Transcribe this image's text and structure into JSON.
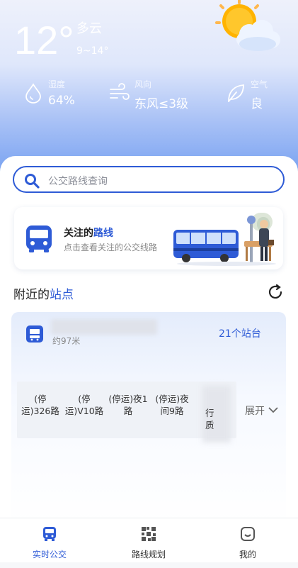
{
  "weather": {
    "temperature": "12°",
    "condition": "多云",
    "range": "9~14°",
    "humidity": {
      "label": "湿度",
      "value": "64%"
    },
    "wind": {
      "label": "风向",
      "value": "东风≤3级"
    },
    "air": {
      "label": "空气",
      "value": "良"
    }
  },
  "search": {
    "placeholder": "公交路线查询"
  },
  "follow_card": {
    "title_prefix": "关注的",
    "title_highlight": "路线",
    "subtitle": "点击查看关注的公交线路"
  },
  "nearby": {
    "title_prefix": "附近的",
    "title_highlight": "站点"
  },
  "station": {
    "distance": "约97米",
    "count": "21个站台",
    "routes": [
      {
        "label": "(停运)326路"
      },
      {
        "label": "(停运)V10路"
      },
      {
        "label": "(停运)夜1路"
      },
      {
        "label": "(停运)夜间9路"
      }
    ],
    "partial_route": "行\n质",
    "expand_label": "展开"
  },
  "tabbar": {
    "items": [
      {
        "label": "实时公交",
        "icon": "bus-icon",
        "active": true
      },
      {
        "label": "路线规划",
        "icon": "route-map-icon",
        "active": false
      },
      {
        "label": "我的",
        "icon": "profile-icon",
        "active": false
      }
    ]
  },
  "colors": {
    "accent": "#2e5bd6",
    "tab_active": "#2e5bd6"
  }
}
